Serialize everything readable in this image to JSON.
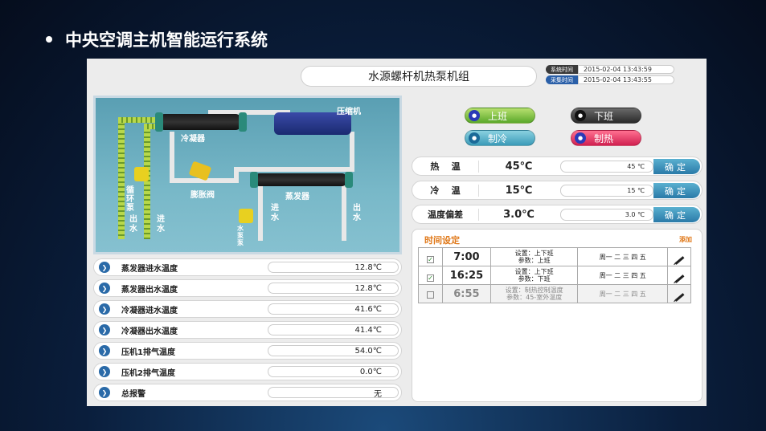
{
  "slide": {
    "title": "中央空调主机智能运行系统"
  },
  "header": {
    "title": "水源螺杆机热泵机组"
  },
  "times": [
    {
      "label": "系统时间",
      "value": "2015-02-04 13:43:59"
    },
    {
      "label": "采集时间",
      "value": "2015-02-04 13:43:55"
    }
  ],
  "diagram": {
    "compressor": "压缩机",
    "condenser": "冷凝器",
    "expansion_valve": "膨胀阀",
    "evaporator": "蒸发器",
    "circulation_pump": "循环泵",
    "water_pump": "水泵泵",
    "out_water": "出\n水",
    "in_water": "进\n水",
    "evap_in": "进\n水",
    "evap_out": "出\n水"
  },
  "sensors": [
    {
      "label": "蒸发器进水温度",
      "value": "12.8℃"
    },
    {
      "label": "蒸发器出水温度",
      "value": "12.8℃"
    },
    {
      "label": "冷凝器进水温度",
      "value": "41.6℃"
    },
    {
      "label": "冷凝器出水温度",
      "value": "41.4℃"
    },
    {
      "label": "压机1排气温度",
      "value": "54.0℃"
    },
    {
      "label": "压机2排气温度",
      "value": "0.0℃"
    },
    {
      "label": "总报警",
      "value": "无"
    }
  ],
  "buttons": {
    "on_duty": "上班",
    "off_duty": "下班",
    "cooling": "制冷",
    "heating": "制热"
  },
  "params": [
    {
      "label": "热    温",
      "value": "45℃",
      "input": "45 ℃",
      "confirm": "确定"
    },
    {
      "label": "冷    温",
      "value": "15℃",
      "input": "15 ℃",
      "confirm": "确定"
    },
    {
      "label": "温度偏差",
      "value": "3.0℃",
      "input": "3.0 ℃",
      "confirm": "确定"
    }
  ],
  "schedule": {
    "title": "时间设定",
    "add": "添加",
    "rows": [
      {
        "checked": "✓",
        "time": "7:00",
        "desc1": "设置：上下班",
        "desc2": "参数：上班",
        "days": "周一 二 三 四 五"
      },
      {
        "checked": "✓",
        "time": "16:25",
        "desc1": "设置：上下班",
        "desc2": "参数：下班",
        "days": "周一 二 三 四 五"
      },
      {
        "checked": "",
        "time": "6:55",
        "desc1": "设置：制热控制温度",
        "desc2": "参数：45-室外温度",
        "days": "周一 二 三 四 五"
      }
    ]
  }
}
